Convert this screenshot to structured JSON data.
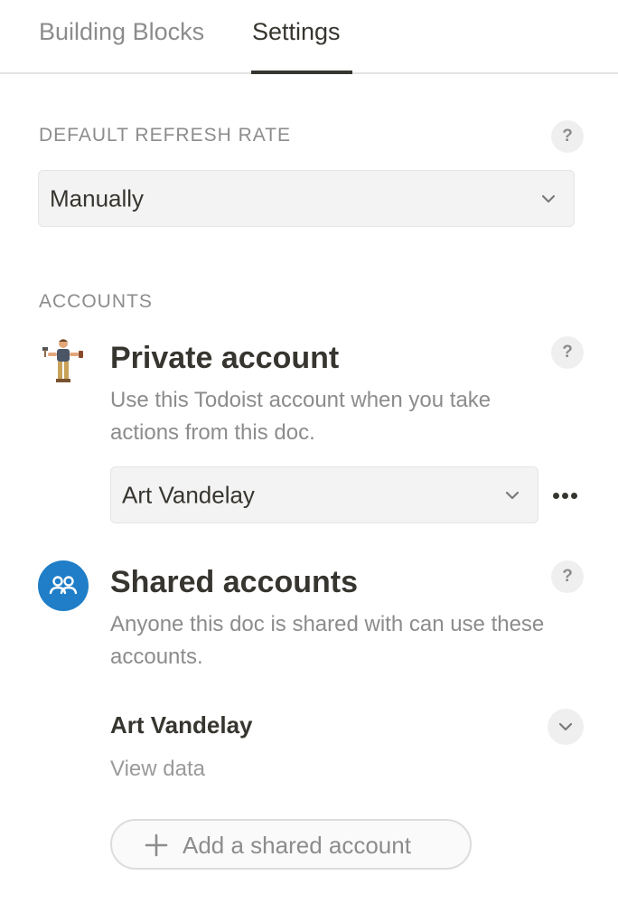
{
  "tabs": [
    {
      "label": "Building Blocks",
      "active": false
    },
    {
      "label": "Settings",
      "active": true
    }
  ],
  "refresh": {
    "heading": "DEFAULT REFRESH RATE",
    "help": "?",
    "selected": "Manually"
  },
  "accounts": {
    "heading": "ACCOUNTS",
    "private": {
      "title": "Private account",
      "description": "Use this Todoist account when you take actions from this doc.",
      "help": "?",
      "selected": "Art Vandelay",
      "more_icon": "more-horizontal-icon"
    },
    "shared": {
      "title": "Shared accounts",
      "description": "Anyone this doc is shared with can use these accounts.",
      "help": "?",
      "icon": "people-icon",
      "items": [
        {
          "name": "Art Vandelay",
          "permission": "View data"
        }
      ],
      "add_label": "Add a shared account"
    }
  },
  "colors": {
    "accent_blue": "#1f7ec7",
    "text": "#37352f",
    "muted": "#8c8c8c"
  }
}
